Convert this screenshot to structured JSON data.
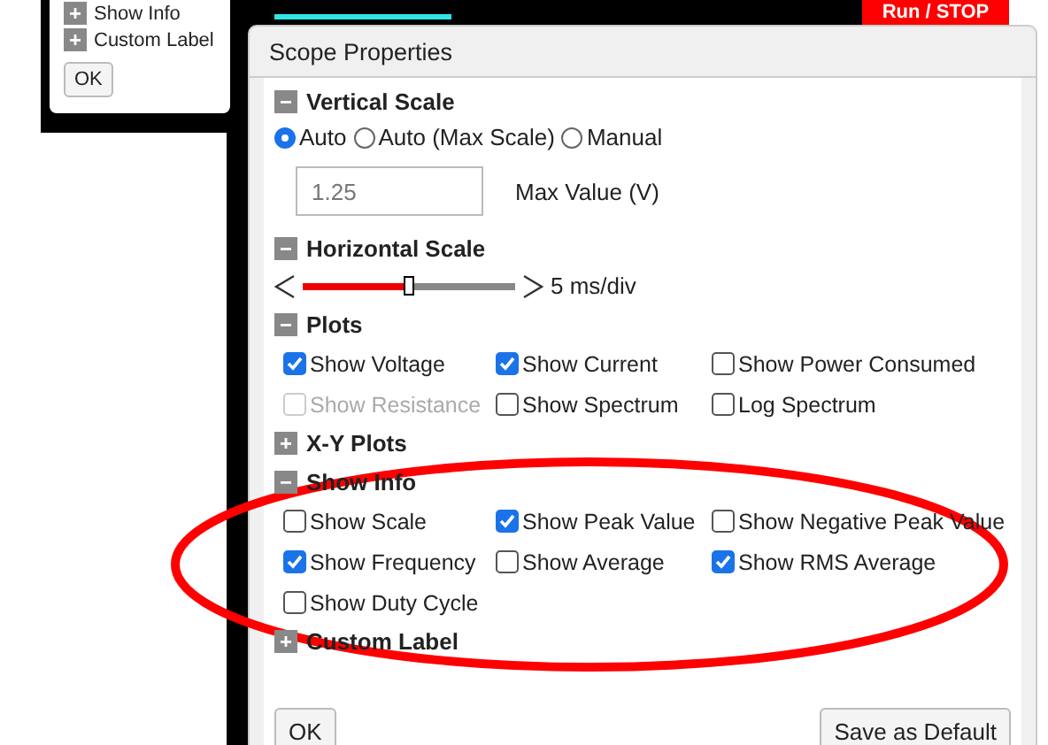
{
  "background": {
    "old_dialog": {
      "sections": [
        {
          "label": "Show Info",
          "expanded": false
        },
        {
          "label": "Custom Label",
          "expanded": false
        }
      ],
      "ok": "OK"
    },
    "run_button": "Run / STOP"
  },
  "dialog": {
    "title": "Scope Properties",
    "sections": [
      {
        "kind": "vertical",
        "label": "Vertical Scale",
        "expanded": true,
        "options": [
          {
            "label": "Auto",
            "selected": true
          },
          {
            "label": "Auto (Max Scale)",
            "selected": false
          },
          {
            "label": "Manual",
            "selected": false
          }
        ],
        "max_value": {
          "value": "1.25",
          "label": "Max Value (V)"
        }
      },
      {
        "kind": "horizontal",
        "label": "Horizontal Scale",
        "expanded": true,
        "level": 0.5,
        "reading": "5 ms/div"
      },
      {
        "kind": "checks",
        "label": "Plots",
        "expanded": true,
        "items": [
          {
            "label": "Show Voltage",
            "checked": true,
            "disabled": false
          },
          {
            "label": "Show Current",
            "checked": true,
            "disabled": false
          },
          {
            "label": "Show Power Consumed",
            "checked": false,
            "disabled": false
          },
          {
            "label": "Show Resistance",
            "checked": false,
            "disabled": true
          },
          {
            "label": "Show Spectrum",
            "checked": false,
            "disabled": false
          },
          {
            "label": "Log Spectrum",
            "checked": false,
            "disabled": false
          }
        ]
      },
      {
        "label": "X-Y Plots",
        "expanded": false
      },
      {
        "kind": "checks",
        "label": "Show Info",
        "expanded": true,
        "items": [
          {
            "label": "Show Scale",
            "checked": false,
            "disabled": false
          },
          {
            "label": "Show Peak Value",
            "checked": true,
            "disabled": false
          },
          {
            "label": "Show Negative Peak Value",
            "checked": false,
            "disabled": false
          },
          {
            "label": "Show Frequency",
            "checked": true,
            "disabled": false
          },
          {
            "label": "Show Average",
            "checked": false,
            "disabled": false
          },
          {
            "label": "Show RMS Average",
            "checked": true,
            "disabled": false
          },
          {
            "label": "Show Duty Cycle",
            "checked": false,
            "disabled": false
          }
        ]
      },
      {
        "label": "Custom Label",
        "expanded": false
      }
    ],
    "buttons": {
      "ok": "OK",
      "save_default": "Save as Default"
    }
  }
}
